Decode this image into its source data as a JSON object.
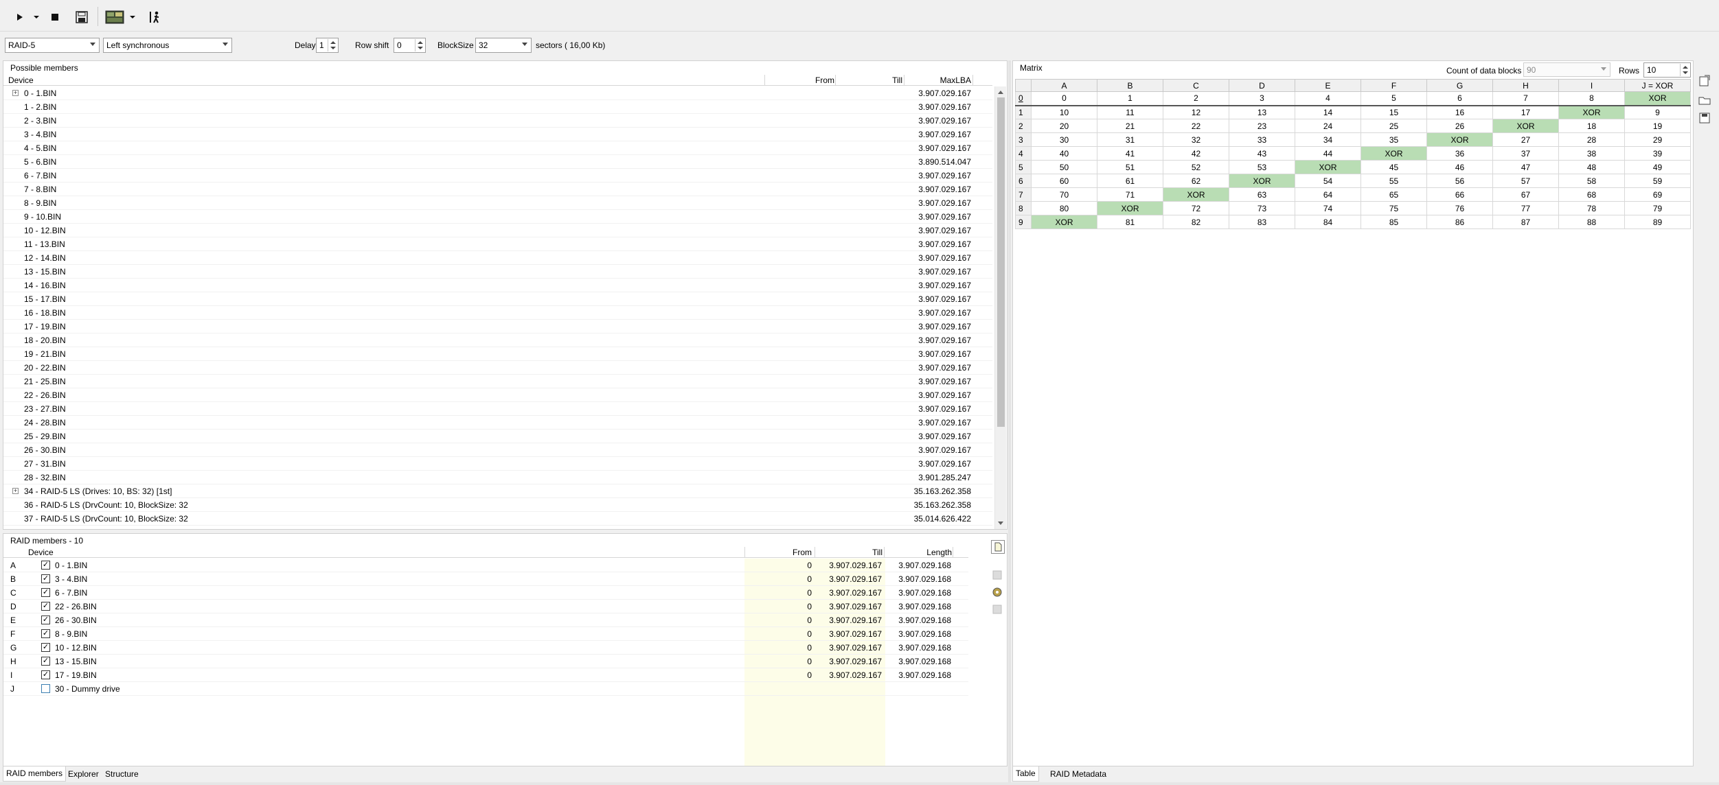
{
  "toolbar": {
    "icons": [
      "play-icon",
      "dropdown-arrow-icon",
      "stop-icon",
      "save-icon",
      "raid-image-icon",
      "dropdown-arrow-icon",
      "walker-icon"
    ]
  },
  "options": {
    "raid_type": "RAID-5",
    "parity_layout": "Left synchronous",
    "delay_label": "Delay",
    "delay_value": "1",
    "row_shift_label": "Row shift",
    "row_shift_value": "0",
    "blocksize_label": "BlockSize",
    "blocksize_value": "32",
    "sectors_text": "sectors ( 16,00 Kb)"
  },
  "possible_members": {
    "title": "Possible members",
    "columns": [
      "Device",
      "From",
      "Till",
      "MaxLBA"
    ],
    "rows": [
      {
        "device": "0 - 1.BIN",
        "maxlba": "3.907.029.167",
        "expandable": true
      },
      {
        "device": "1 - 2.BIN",
        "maxlba": "3.907.029.167"
      },
      {
        "device": "2 - 3.BIN",
        "maxlba": "3.907.029.167"
      },
      {
        "device": "3 - 4.BIN",
        "maxlba": "3.907.029.167"
      },
      {
        "device": "4 - 5.BIN",
        "maxlba": "3.907.029.167"
      },
      {
        "device": "5 - 6.BIN",
        "maxlba": "3.890.514.047"
      },
      {
        "device": "6 - 7.BIN",
        "maxlba": "3.907.029.167"
      },
      {
        "device": "7 - 8.BIN",
        "maxlba": "3.907.029.167"
      },
      {
        "device": "8 - 9.BIN",
        "maxlba": "3.907.029.167"
      },
      {
        "device": "9 - 10.BIN",
        "maxlba": "3.907.029.167"
      },
      {
        "device": "10 - 12.BIN",
        "maxlba": "3.907.029.167"
      },
      {
        "device": "11 - 13.BIN",
        "maxlba": "3.907.029.167"
      },
      {
        "device": "12 - 14.BIN",
        "maxlba": "3.907.029.167"
      },
      {
        "device": "13 - 15.BIN",
        "maxlba": "3.907.029.167"
      },
      {
        "device": "14 - 16.BIN",
        "maxlba": "3.907.029.167"
      },
      {
        "device": "15 - 17.BIN",
        "maxlba": "3.907.029.167"
      },
      {
        "device": "16 - 18.BIN",
        "maxlba": "3.907.029.167"
      },
      {
        "device": "17 - 19.BIN",
        "maxlba": "3.907.029.167"
      },
      {
        "device": "18 - 20.BIN",
        "maxlba": "3.907.029.167"
      },
      {
        "device": "19 - 21.BIN",
        "maxlba": "3.907.029.167"
      },
      {
        "device": "20 - 22.BIN",
        "maxlba": "3.907.029.167"
      },
      {
        "device": "21 - 25.BIN",
        "maxlba": "3.907.029.167"
      },
      {
        "device": "22 - 26.BIN",
        "maxlba": "3.907.029.167"
      },
      {
        "device": "23 - 27.BIN",
        "maxlba": "3.907.029.167"
      },
      {
        "device": "24 - 28.BIN",
        "maxlba": "3.907.029.167"
      },
      {
        "device": "25 - 29.BIN",
        "maxlba": "3.907.029.167"
      },
      {
        "device": "26 - 30.BIN",
        "maxlba": "3.907.029.167"
      },
      {
        "device": "27 - 31.BIN",
        "maxlba": "3.907.029.167"
      },
      {
        "device": "28 - 32.BIN",
        "maxlba": "3.901.285.247"
      },
      {
        "device": "34 - RAID-5 LS (Drives: 10, BS: 32) [1st]",
        "maxlba": "35.163.262.358",
        "expandable": true
      },
      {
        "device": "36 - RAID-5 LS (DrvCount: 10, BlockSize: 32",
        "maxlba": "35.163.262.358"
      },
      {
        "device": "37 - RAID-5 LS (DrvCount: 10, BlockSize: 32",
        "maxlba": "35.014.626.422"
      }
    ]
  },
  "raid_members": {
    "title": "RAID members - 10",
    "columns": [
      "Device",
      "From",
      "Till",
      "Length"
    ],
    "rows": [
      {
        "letter": "A",
        "device": "0 - 1.BIN",
        "from": "0",
        "till": "3.907.029.167",
        "length": "3.907.029.168",
        "checked": true
      },
      {
        "letter": "B",
        "device": "3 - 4.BIN",
        "from": "0",
        "till": "3.907.029.167",
        "length": "3.907.029.168",
        "checked": true
      },
      {
        "letter": "C",
        "device": "6 - 7.BIN",
        "from": "0",
        "till": "3.907.029.167",
        "length": "3.907.029.168",
        "checked": true
      },
      {
        "letter": "D",
        "device": "22 - 26.BIN",
        "from": "0",
        "till": "3.907.029.167",
        "length": "3.907.029.168",
        "checked": true
      },
      {
        "letter": "E",
        "device": "26 - 30.BIN",
        "from": "0",
        "till": "3.907.029.167",
        "length": "3.907.029.168",
        "checked": true
      },
      {
        "letter": "F",
        "device": "8 - 9.BIN",
        "from": "0",
        "till": "3.907.029.167",
        "length": "3.907.029.168",
        "checked": true
      },
      {
        "letter": "G",
        "device": "10 - 12.BIN",
        "from": "0",
        "till": "3.907.029.167",
        "length": "3.907.029.168",
        "checked": true
      },
      {
        "letter": "H",
        "device": "13 - 15.BIN",
        "from": "0",
        "till": "3.907.029.167",
        "length": "3.907.029.168",
        "checked": true
      },
      {
        "letter": "I",
        "device": "17 - 19.BIN",
        "from": "0",
        "till": "3.907.029.167",
        "length": "3.907.029.168",
        "checked": true
      },
      {
        "letter": "J",
        "device": "30 - Dummy drive",
        "from": "",
        "till": "",
        "length": "",
        "checked": false
      }
    ]
  },
  "left_tabs": [
    "RAID members",
    "Explorer",
    "Structure"
  ],
  "matrix": {
    "title": "Matrix",
    "count_label": "Count of data blocks",
    "count_value": "90",
    "rows_label": "Rows",
    "rows_value": "10",
    "columns": [
      "A",
      "B",
      "C",
      "D",
      "E",
      "F",
      "G",
      "H",
      "I",
      "J = XOR"
    ],
    "rows": [
      {
        "label": "0",
        "cells": [
          "0",
          "1",
          "2",
          "3",
          "4",
          "5",
          "6",
          "7",
          "8",
          "XOR"
        ]
      },
      {
        "label": "1",
        "cells": [
          "10",
          "11",
          "12",
          "13",
          "14",
          "15",
          "16",
          "17",
          "XOR",
          "9"
        ]
      },
      {
        "label": "2",
        "cells": [
          "20",
          "21",
          "22",
          "23",
          "24",
          "25",
          "26",
          "XOR",
          "18",
          "19"
        ]
      },
      {
        "label": "3",
        "cells": [
          "30",
          "31",
          "32",
          "33",
          "34",
          "35",
          "XOR",
          "27",
          "28",
          "29"
        ]
      },
      {
        "label": "4",
        "cells": [
          "40",
          "41",
          "42",
          "43",
          "44",
          "XOR",
          "36",
          "37",
          "38",
          "39"
        ]
      },
      {
        "label": "5",
        "cells": [
          "50",
          "51",
          "52",
          "53",
          "XOR",
          "45",
          "46",
          "47",
          "48",
          "49"
        ]
      },
      {
        "label": "6",
        "cells": [
          "60",
          "61",
          "62",
          "XOR",
          "54",
          "55",
          "56",
          "57",
          "58",
          "59"
        ]
      },
      {
        "label": "7",
        "cells": [
          "70",
          "71",
          "XOR",
          "63",
          "64",
          "65",
          "66",
          "67",
          "68",
          "69"
        ]
      },
      {
        "label": "8",
        "cells": [
          "80",
          "XOR",
          "72",
          "73",
          "74",
          "75",
          "76",
          "77",
          "78",
          "79"
        ]
      },
      {
        "label": "9",
        "cells": [
          "XOR",
          "81",
          "82",
          "83",
          "84",
          "85",
          "86",
          "87",
          "88",
          "89"
        ]
      }
    ]
  },
  "right_tabs": [
    "Table",
    "RAID Metadata"
  ],
  "colors": {
    "xor_cell": "#b9ddb4",
    "from_column_bg": "#fdfde8",
    "checkbox_blue": "#3c7fb1"
  }
}
